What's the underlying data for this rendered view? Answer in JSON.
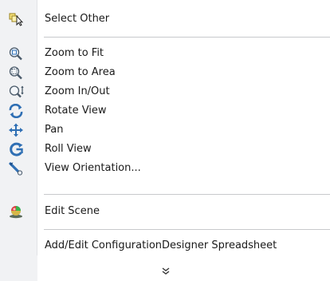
{
  "menu": {
    "items": [
      {
        "label": "Select Other",
        "icon": "select-other-icon"
      },
      {
        "label": "Zoom to Fit",
        "icon": "zoom-to-fit-icon"
      },
      {
        "label": "Zoom to Area",
        "icon": "zoom-to-area-icon"
      },
      {
        "label": "Zoom In/Out",
        "icon": "zoom-in-out-icon"
      },
      {
        "label": "Rotate View",
        "icon": "rotate-view-icon"
      },
      {
        "label": "Pan",
        "icon": "pan-icon"
      },
      {
        "label": "Roll View",
        "icon": "roll-view-icon"
      },
      {
        "label": "View Orientation...",
        "icon": "view-orientation-icon"
      },
      {
        "label": "Edit Scene",
        "icon": "edit-scene-icon"
      },
      {
        "label": "Add/Edit ConfigurationDesigner Spreadsheet",
        "icon": ""
      }
    ],
    "more_glyph": "»"
  }
}
